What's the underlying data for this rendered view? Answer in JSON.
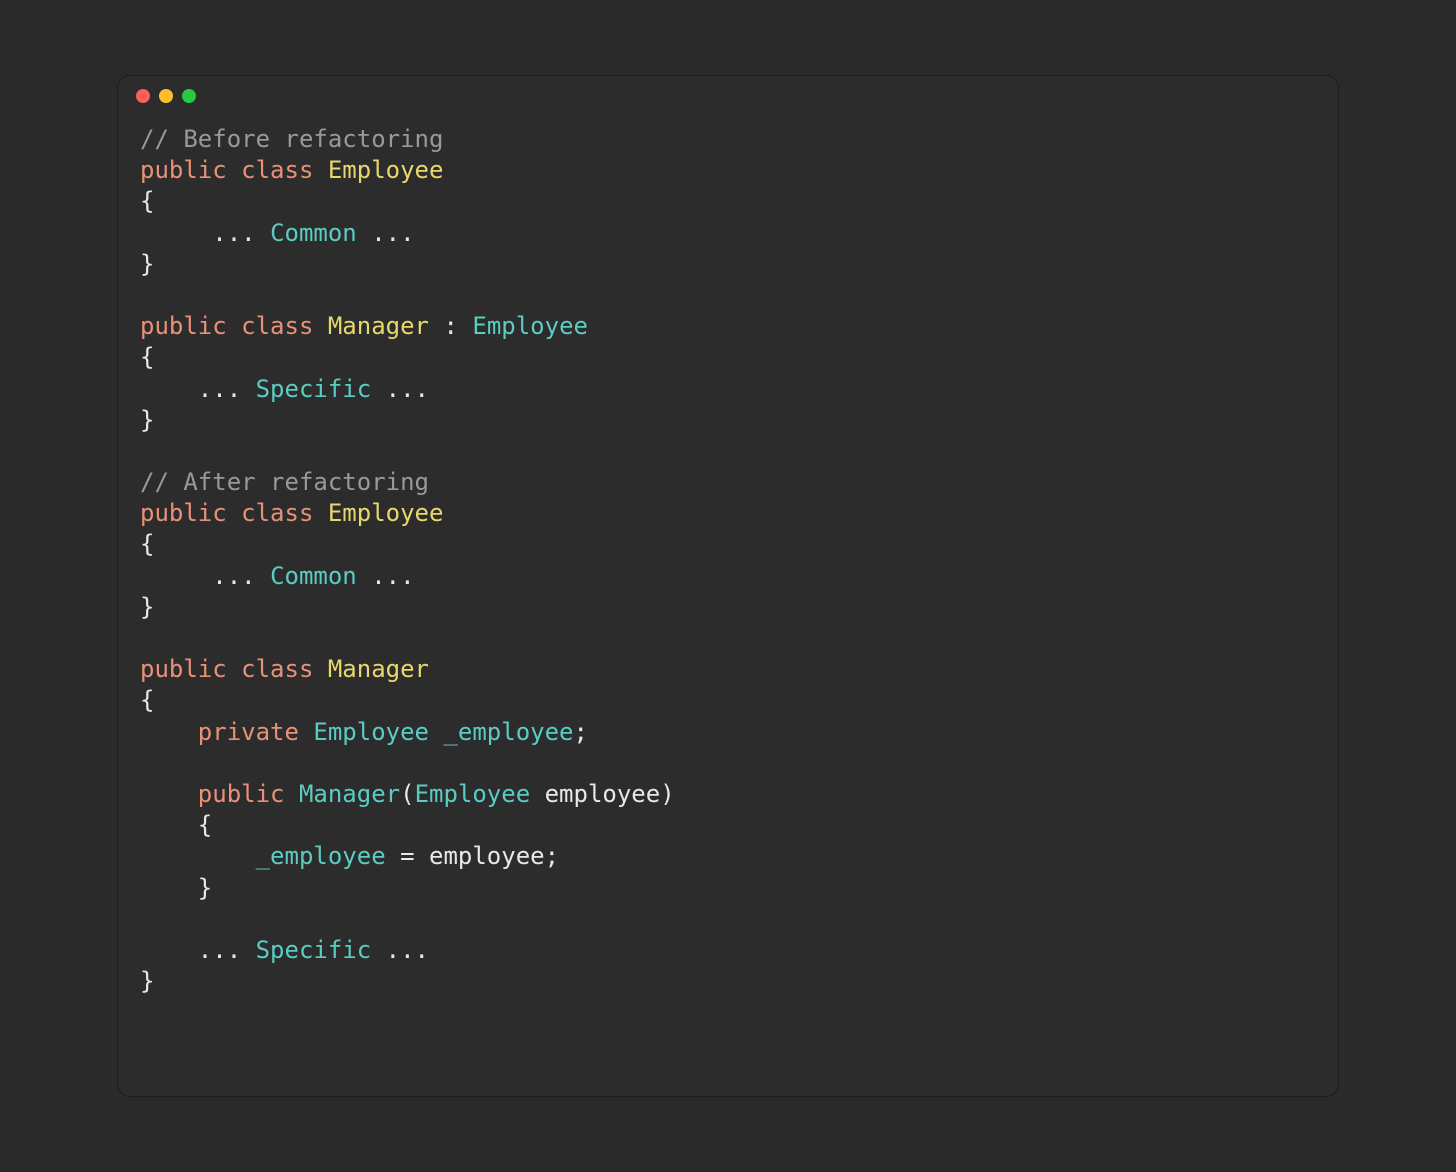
{
  "colors": {
    "bg": "#2c2c2c",
    "comment": "#999999",
    "keyword": "#e89178",
    "classname": "#e8d86b",
    "type": "#5bccc3",
    "default": "#e8e8e8"
  },
  "code": {
    "comment_before": "// Before refactoring",
    "comment_after": "// After refactoring",
    "kw_public": "public",
    "kw_class": "class",
    "kw_private": "private",
    "cls_employee": "Employee",
    "cls_manager": "Manager",
    "type_employee": "Employee",
    "ident_common": "Common",
    "ident_specific": "Specific",
    "ident_manager_ctor": "Manager",
    "field_employee": "_employee",
    "param_employee": "employee",
    "assign_lhs": "_employee",
    "assign_rhs": "employee",
    "dots": "...",
    "brace_open": "{",
    "brace_close": "}",
    "paren_open": "(",
    "paren_close": ")",
    "colon": ":",
    "semicolon": ";",
    "equals": "=",
    "space": " "
  }
}
